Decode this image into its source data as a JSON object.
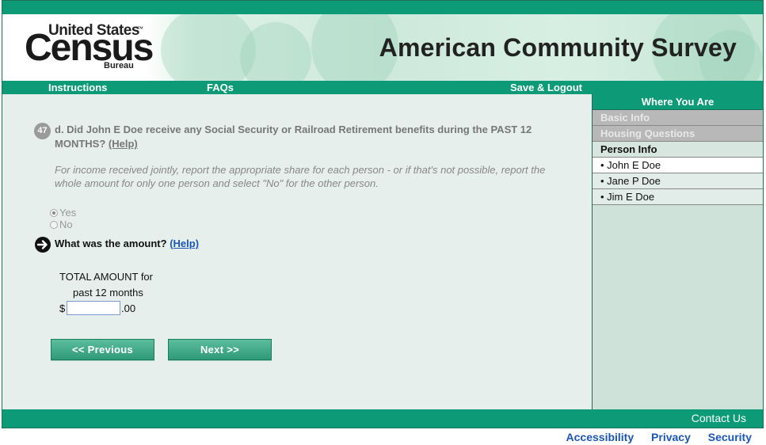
{
  "branding": {
    "logo_line1": "United States",
    "logo_tm": "™",
    "logo_main": "Census",
    "logo_line3": "Bureau",
    "survey_title": "American Community Survey"
  },
  "nav": {
    "instructions": "Instructions",
    "faqs": "FAQs",
    "save_logout": "Save & Logout"
  },
  "question": {
    "number": "47",
    "text": "d. Did John E Doe receive any Social Security or Railroad Retirement benefits during the PAST 12 MONTHS?",
    "help": "(Help)",
    "note": "For income received jointly, report the appropriate share for each person - or if that's not possible, report the whole amount for only one person and select \"No\" for the other person.",
    "options": [
      {
        "label": "Yes",
        "checked": true
      },
      {
        "label": "No",
        "checked": false
      }
    ]
  },
  "subquestion": {
    "text": "What was the amount?",
    "help": "(Help)",
    "amount_label_1": "TOTAL AMOUNT for",
    "amount_label_2": "past 12 months",
    "currency": "$",
    "value": "",
    "cents": ".00"
  },
  "buttons": {
    "previous": "<<   Previous",
    "next": "Next   >>"
  },
  "sidebar": {
    "title": "Where You Are",
    "sections": [
      {
        "label": "Basic Info",
        "state": "disabled"
      },
      {
        "label": "Housing Questions",
        "state": "disabled"
      },
      {
        "label": "Person Info",
        "state": "header"
      }
    ],
    "persons": [
      {
        "label": "• John E Doe",
        "current": true
      },
      {
        "label": "• Jane P Doe",
        "current": false
      },
      {
        "label": "• Jim E Doe",
        "current": false
      }
    ]
  },
  "footer": {
    "contact": "Contact Us",
    "links": [
      "Accessibility",
      "Privacy",
      "Security"
    ]
  },
  "colors": {
    "brand_green": "#0c9b76",
    "link_blue": "#1a56b8"
  }
}
